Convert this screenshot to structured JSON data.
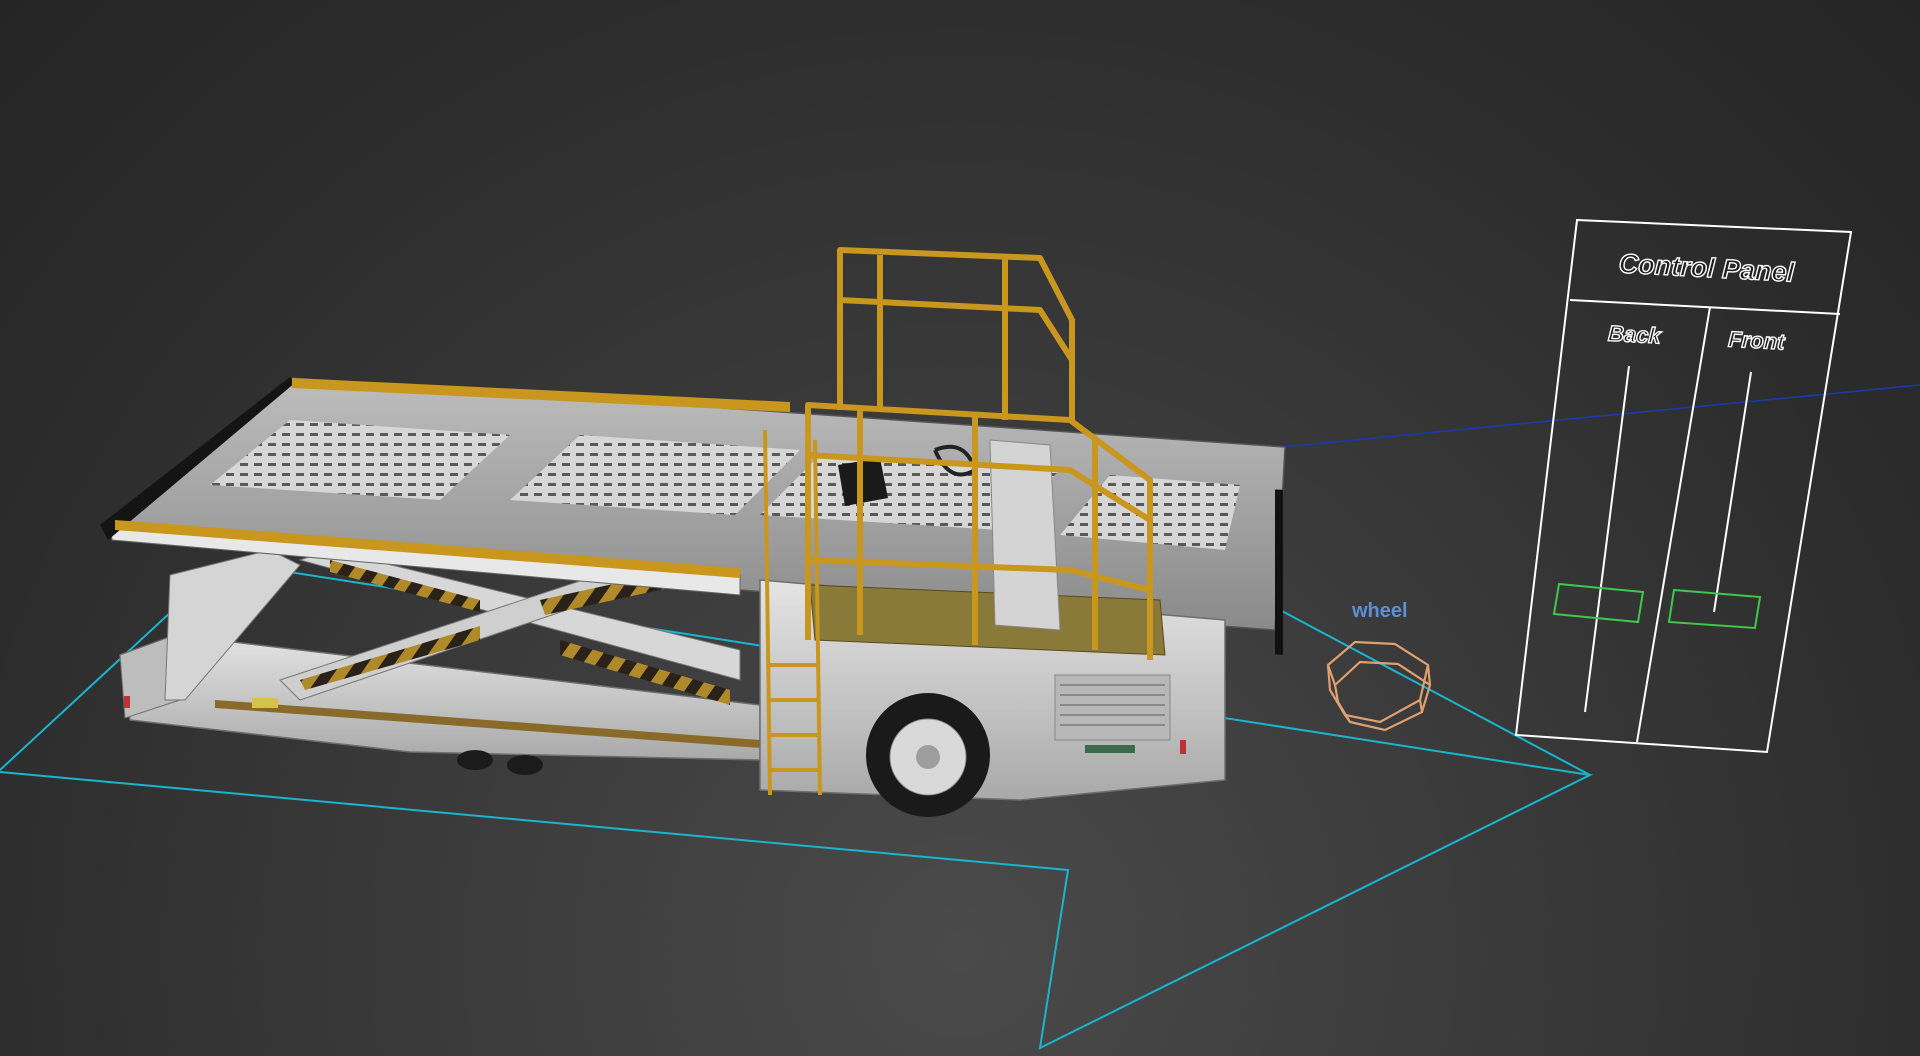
{
  "viewport": {
    "kind": "3d-viewport",
    "background": "#333333"
  },
  "control_panel": {
    "title": "Control Panel",
    "columns": [
      {
        "label": "Back"
      },
      {
        "label": "Front"
      }
    ],
    "frame_color": "#ffffff",
    "handle_color": "#3ec94a"
  },
  "helper_object": {
    "label": "wheel",
    "gizmo_color": "#e0a070",
    "label_color": "#5d8fd8"
  },
  "selection_shape": {
    "color": "#19b5d0"
  },
  "link_line": {
    "color": "#1a3aa8"
  },
  "vehicle": {
    "name": "scissor-lift-catering-truck",
    "body_color": "#cfcfcf",
    "rail_color": "#c9961e",
    "tire_color": "#1a1a1a"
  }
}
